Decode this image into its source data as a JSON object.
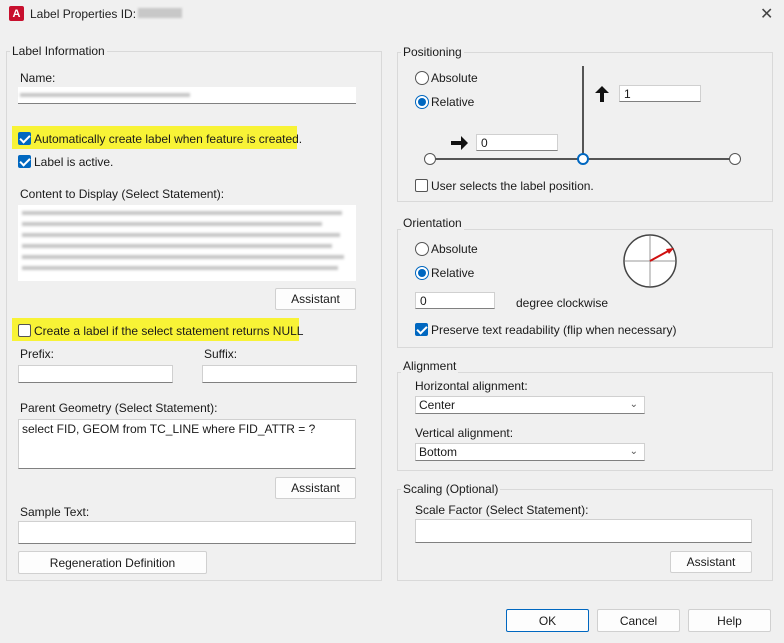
{
  "window": {
    "title": "Label Properties ID: "
  },
  "label_information": {
    "group_title": "Label Information",
    "name_label": "Name:",
    "auto_create_label": "Automatically create label when feature is created.",
    "auto_create_checked": true,
    "label_active": "Label is active.",
    "label_active_checked": true,
    "content_label": "Content to Display (Select Statement):",
    "assistant_label": "Assistant",
    "create_null_label": "Create a label if the select statement returns NULL",
    "create_null_checked": false,
    "prefix_label": "Prefix:",
    "prefix_value": "",
    "suffix_label": "Suffix:",
    "suffix_value": "",
    "parent_geometry_label": "Parent Geometry (Select Statement):",
    "parent_geometry_value": "select FID, GEOM from TC_LINE where FID_ATTR = ?",
    "parent_assistant_label": "Assistant",
    "sample_text_label": "Sample Text:",
    "sample_text_value": "",
    "regeneration_label": "Regeneration Definition"
  },
  "positioning": {
    "group_title": "Positioning",
    "absolute_label": "Absolute",
    "relative_label": "Relative",
    "selected": "Relative",
    "y_offset": "1",
    "x_offset": "0",
    "user_selects_label": "User selects the label position.",
    "user_selects_checked": false
  },
  "orientation": {
    "group_title": "Orientation",
    "absolute_label": "Absolute",
    "relative_label": "Relative",
    "selected": "Relative",
    "degree_value": "0",
    "degree_label": "degree clockwise",
    "preserve_label": "Preserve text readability (flip when necessary)",
    "preserve_checked": true
  },
  "alignment": {
    "group_title": "Alignment",
    "horizontal_label": "Horizontal alignment:",
    "horizontal_value": "Center",
    "vertical_label": "Vertical alignment:",
    "vertical_value": "Bottom"
  },
  "scaling": {
    "group_title": "Scaling (Optional)",
    "scale_factor_label": "Scale Factor (Select Statement):",
    "scale_factor_value": "",
    "assistant_label": "Assistant"
  },
  "footer": {
    "ok_label": "OK",
    "cancel_label": "Cancel",
    "help_label": "Help"
  },
  "icons": {
    "app": "autocad-app-icon",
    "close": "close-icon",
    "up_arrow": "arrow-up-icon",
    "right_arrow": "arrow-right-icon",
    "dropdown": "chevron-down-icon",
    "compass": "orientation-dial-icon"
  },
  "colors": {
    "accent": "#0067c0",
    "highlight": "#f8f336",
    "app_icon": "#c8102e",
    "dial_needle": "#d01010"
  }
}
